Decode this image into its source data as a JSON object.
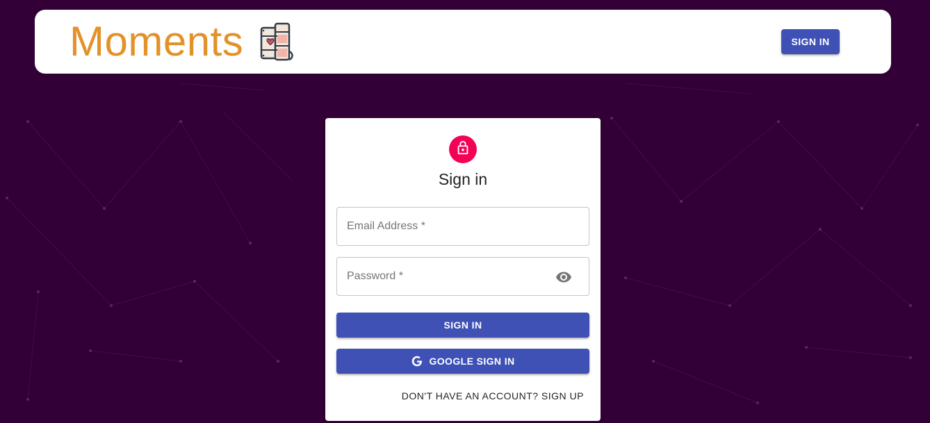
{
  "appbar": {
    "title": "Moments",
    "signin_label": "SIGN IN",
    "logo_icon": "film-strip-heart-logo"
  },
  "auth": {
    "lock_icon": "lock-icon",
    "title": "Sign in",
    "email_placeholder": "Email Address *",
    "password_placeholder": "Password *",
    "visibility_icon": "eye-icon",
    "signin_label": "SIGN IN",
    "google_signin_label": "GOOGLE SIGN IN",
    "google_icon": "google-icon",
    "signup_link": "DON'T HAVE AN ACCOUNT? SIGN UP"
  },
  "colors": {
    "background": "#320036",
    "brand_text": "#e3922a",
    "primary_button": "#3f51b5",
    "avatar": "#f50057"
  }
}
